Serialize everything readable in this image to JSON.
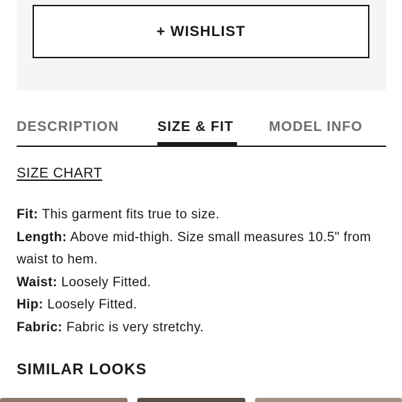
{
  "actions": {
    "wishlist_label": "+ WISHLIST"
  },
  "tabs": [
    {
      "label": "DESCRIPTION",
      "active": false
    },
    {
      "label": "SIZE & FIT",
      "active": true
    },
    {
      "label": "MODEL INFO",
      "active": false
    }
  ],
  "size_chart_link": "SIZE CHART",
  "details": [
    {
      "key": "Fit:",
      "value": " This garment fits true to size."
    },
    {
      "key": "Length:",
      "value": " Above mid-thigh. Size small measures 10.5\" from waist to hem."
    },
    {
      "key": "Waist:",
      "value": " Loosely Fitted."
    },
    {
      "key": "Hip:",
      "value": " Loosely Fitted."
    },
    {
      "key": "Fabric:",
      "value": " Fabric is very stretchy."
    }
  ],
  "similar_heading": "SIMILAR LOOKS",
  "colors": {
    "text": "#1a1a1a",
    "inactive_tab": "#6e6e6e",
    "panel_bg": "#f5f5f5"
  }
}
